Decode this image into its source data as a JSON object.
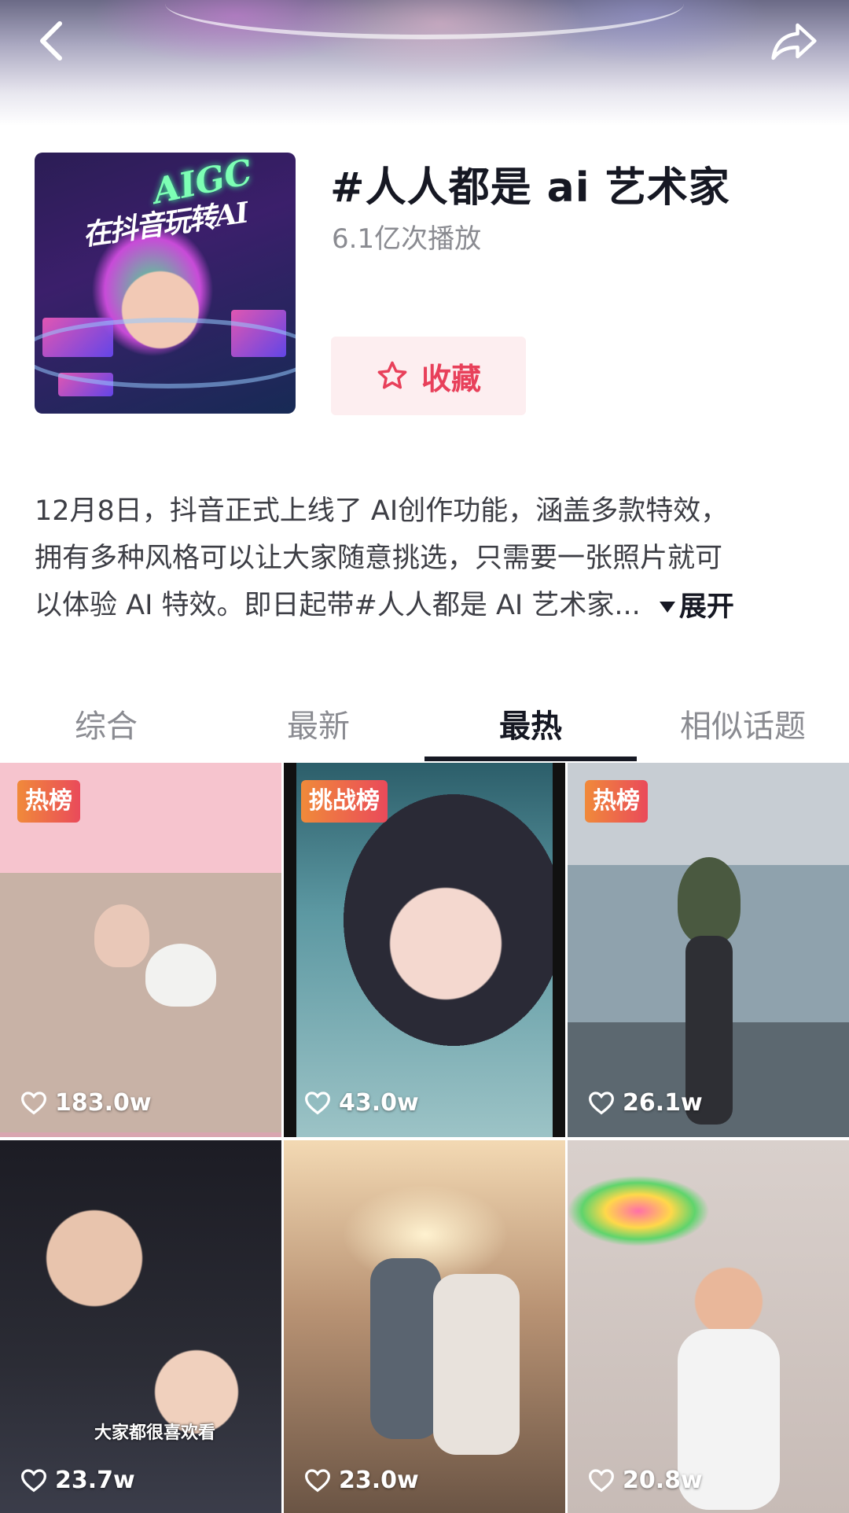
{
  "nav": {
    "back_icon": "chevron-left-icon",
    "share_icon": "share-arrow-icon"
  },
  "topic": {
    "cover_text_1": "AIGC",
    "cover_text_2": "在抖音玩转AI",
    "title": "#人人都是 ai 艺术家",
    "plays": "6.1亿次播放",
    "favorite_label": "收藏",
    "favorite_icon": "star-icon",
    "accent_color": "#e8405a"
  },
  "description": {
    "line1": "12月8日，抖音正式上线了 AI创作功能，涵盖多款特效，",
    "line2": "拥有多种风格可以让大家随意挑选，只需要一张照片就可",
    "line3": "以体验 AI 特效。即日起带#人人都是 AI 艺术家...",
    "expand_label": "展开"
  },
  "tabs": [
    {
      "label": "综合"
    },
    {
      "label": "最新"
    },
    {
      "label": "最热",
      "active": true
    },
    {
      "label": "相似话题"
    }
  ],
  "videos": [
    {
      "badge": "热榜",
      "likes": "183.0w"
    },
    {
      "badge": "挑战榜",
      "likes": "43.0w"
    },
    {
      "badge": "热榜",
      "likes": "26.1w"
    },
    {
      "badge": "",
      "likes": "23.7w",
      "overlay_text": "大家都很喜欢看"
    },
    {
      "badge": "",
      "likes": "23.0w"
    },
    {
      "badge": "",
      "likes": "20.8w"
    }
  ]
}
